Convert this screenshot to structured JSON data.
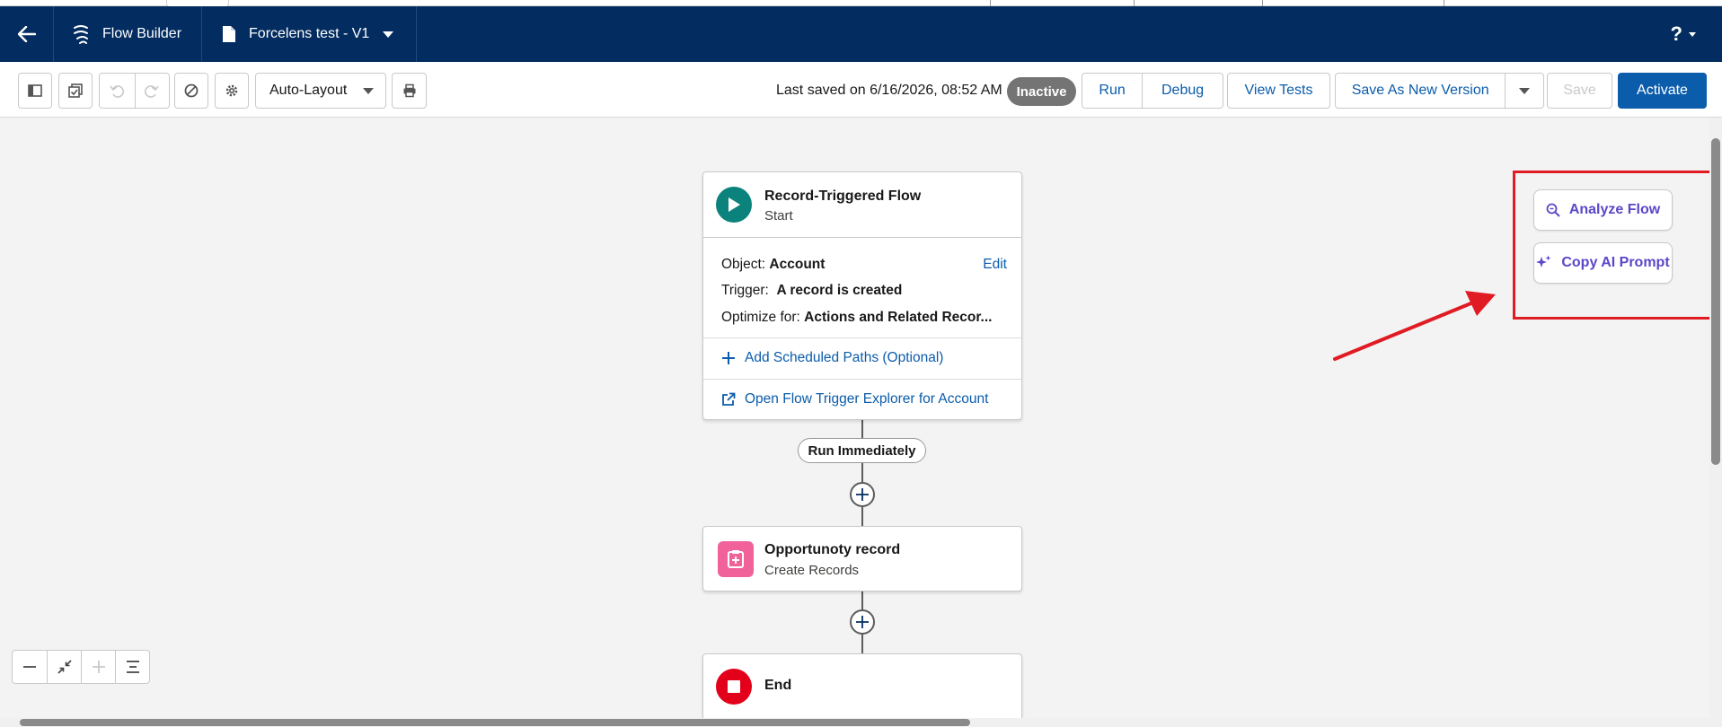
{
  "header": {
    "app_name": "Flow Builder",
    "flow_name": "Forcelens test - V1",
    "help_label": "?"
  },
  "toolbar": {
    "layout_select": "Auto-Layout",
    "last_saved": "Last saved on 6/16/2026, 08:52 AM",
    "status_badge": "Inactive",
    "run_label": "Run",
    "debug_label": "Debug",
    "view_tests_label": "View Tests",
    "save_as_new_label": "Save As New Version",
    "save_label": "Save",
    "activate_label": "Activate"
  },
  "start_node": {
    "title": "Record-Triggered Flow",
    "subtitle": "Start",
    "object_label": "Object:",
    "object_value": "Account",
    "edit_label": "Edit",
    "trigger_label": "Trigger:",
    "trigger_value": "A record is created",
    "optimize_label": "Optimize for:",
    "optimize_value": "Actions and Related Recor...",
    "scheduled_paths_label": "Add Scheduled Paths (Optional)",
    "trigger_explorer_label": "Open Flow Trigger Explorer for Account"
  },
  "path_label": "Run Immediately",
  "create_node": {
    "title": "Opportunoty record",
    "subtitle": "Create Records"
  },
  "end_node": {
    "title": "End"
  },
  "ai_panel": {
    "analyze_label": "Analyze Flow",
    "copy_prompt_label": "Copy AI Prompt"
  },
  "colors": {
    "header_bg": "#032d60",
    "primary_blue": "#0b5cab",
    "start_icon": "#0b827c",
    "create_icon": "#f1629b",
    "end_icon": "#e3001b",
    "ai_purple": "#5a47c9",
    "annotation_red": "#e01b24"
  },
  "icons": {
    "back": "arrow-left-icon",
    "app": "flow-icon",
    "flow_file": "document-icon",
    "help": "question-icon"
  }
}
